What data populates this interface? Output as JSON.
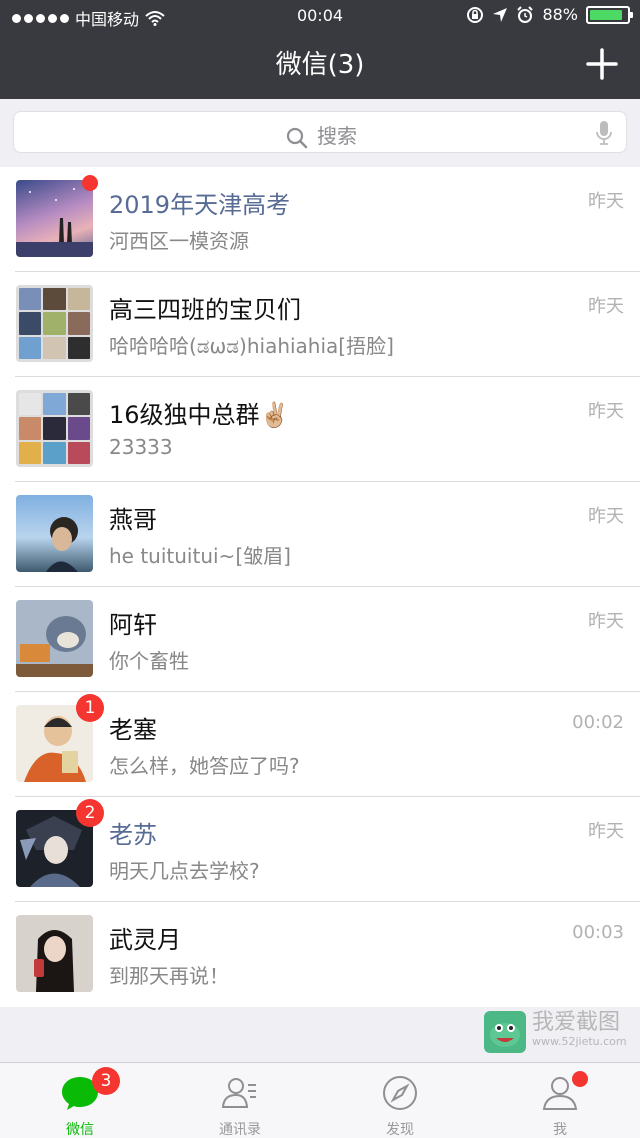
{
  "status_bar": {
    "carrier": "中国移动",
    "time": "00:04",
    "battery": "88%",
    "battery_level": 0.88
  },
  "header": {
    "title": "微信(3)",
    "add_icon": "plus-icon"
  },
  "search": {
    "placeholder": "搜索",
    "icon": "search-icon",
    "voice_icon": "microphone-icon"
  },
  "chats": [
    {
      "name": "2019年天津高考",
      "message": "河西区一模资源",
      "time": "昨天",
      "unread_dot": true
    },
    {
      "name": "高三四班的宝贝们",
      "message": "哈哈哈哈(ಡωಡ)hiahiahia[捂脸]",
      "time": "昨天"
    },
    {
      "name": "16级独中总群✌🏼",
      "message": "23333",
      "time": "昨天"
    },
    {
      "name": "燕哥",
      "message": "he tuituitui~[皱眉]",
      "time": "昨天"
    },
    {
      "name": "阿轩",
      "message": "你个畜牲",
      "time": "昨天"
    },
    {
      "name": "老塞",
      "message": "怎么样，她答应了吗?",
      "time": "00:02",
      "badge": "1"
    },
    {
      "name": "老苏",
      "message": "明天几点去学校?",
      "time": "昨天",
      "badge": "2"
    },
    {
      "name": "武灵月",
      "message": "到那天再说！",
      "time": "00:03"
    }
  ],
  "watermark": {
    "title": "我爱截图",
    "url": "www.52jietu.com"
  },
  "tabbar": {
    "tabs": [
      {
        "label": "微信",
        "icon": "chat-bubble-icon",
        "badge": "3",
        "active": true
      },
      {
        "label": "通讯录",
        "icon": "contacts-icon"
      },
      {
        "label": "发现",
        "icon": "compass-icon"
      },
      {
        "label": "我",
        "icon": "profile-icon",
        "dot": true
      }
    ]
  },
  "colors": {
    "header_bg": "#393a3f",
    "accent_green": "#09bb07",
    "badge_red": "#f43530",
    "group_name_blue": "#576b95"
  }
}
